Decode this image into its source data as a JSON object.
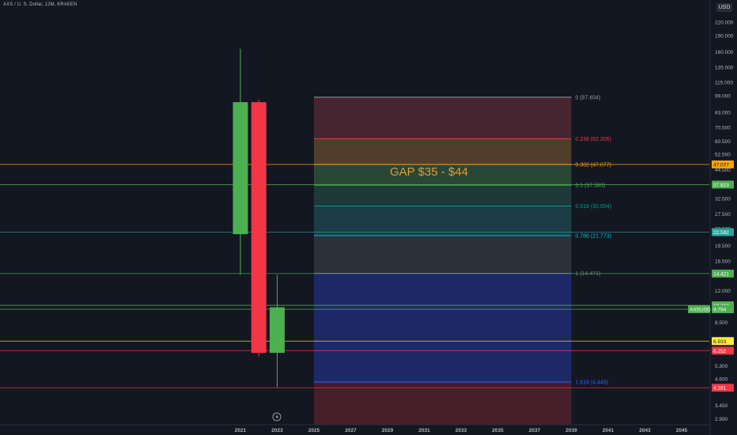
{
  "header": {
    "symbol": "AXS / U. S. Dollar, 12M, KRAKEN",
    "currency": "USD"
  },
  "chart_data": {
    "type": "candlestick",
    "y_scale": "log",
    "ylim": [
      2.8,
      280
    ],
    "y_ticks": [
      {
        "v": 220,
        "label": "220.000"
      },
      {
        "v": 190,
        "label": "190.000"
      },
      {
        "v": 160,
        "label": "160.000"
      },
      {
        "v": 135,
        "label": "135.000"
      },
      {
        "v": 115,
        "label": "115.000"
      },
      {
        "v": 99,
        "label": "99.000"
      },
      {
        "v": 83,
        "label": "83.000"
      },
      {
        "v": 70.5,
        "label": "70.500"
      },
      {
        "v": 60.5,
        "label": "60.500"
      },
      {
        "v": 52.5,
        "label": "52.500"
      },
      {
        "v": 44.5,
        "label": "44.500"
      },
      {
        "v": 32.5,
        "label": "32.500"
      },
      {
        "v": 27.5,
        "label": "27.500"
      },
      {
        "v": 23.5,
        "label": "23.500"
      },
      {
        "v": 19.5,
        "label": "19.500"
      },
      {
        "v": 16.5,
        "label": "16.500"
      },
      {
        "v": 12,
        "label": "12.000"
      },
      {
        "v": 8.5,
        "label": "8.500"
      },
      {
        "v": 6.3,
        "label": "6.300"
      },
      {
        "v": 5.3,
        "label": "5.300"
      },
      {
        "v": 4.6,
        "label": "4.600"
      },
      {
        "v": 3.45,
        "label": "3.450"
      },
      {
        "v": 2.99,
        "label": "2.990"
      }
    ],
    "x_ticks": [
      "2021",
      "2023",
      "2025",
      "2027",
      "2029",
      "2031",
      "2033",
      "2035",
      "2037",
      "2039",
      "2041",
      "2043",
      "2045"
    ],
    "xlim": [
      2019.3,
      2046.6
    ],
    "candles": [
      {
        "t": 2021,
        "open": 22.1,
        "high": 165,
        "low": 14.2,
        "close": 92.5
      },
      {
        "t": 2022,
        "open": 92.5,
        "high": 95,
        "low": 5.85,
        "close": 6.1
      },
      {
        "t": 2023,
        "open": 6.1,
        "high": 14.2,
        "low": 4.2,
        "close": 10.0
      }
    ],
    "fib_retracement": {
      "x_start": 2025.0,
      "x_end": 2039.0,
      "levels": [
        {
          "ratio": "0",
          "price": 97.604,
          "label": "0 (97.604)",
          "color": "#9598a1",
          "fill": "#4a2631"
        },
        {
          "ratio": "0.236",
          "price": 62.206,
          "label": "0.236 (62.206)",
          "color": "#f23645",
          "fill": "#53402c"
        },
        {
          "ratio": "0.382",
          "price": 47.077,
          "label": "0.382 (47.077)",
          "color": "#ff9800",
          "fill": "#2a4a37"
        },
        {
          "ratio": "0.5",
          "price": 37.583,
          "label": "0.5 (37.583)",
          "color": "#4caf50",
          "fill": "#1d3b3c"
        },
        {
          "ratio": "0.618",
          "price": 30.004,
          "label": "0.618 (30.004)",
          "color": "#089981",
          "fill": "#1c3f48"
        },
        {
          "ratio": "0.786",
          "price": 21.773,
          "label": "0.786 (21.773)",
          "color": "#00bcd4",
          "fill": "#2d313a"
        },
        {
          "ratio": "1",
          "price": 14.471,
          "label": "1 (14.471)",
          "color": "#787b86",
          "fill": "#1d2a6b"
        },
        {
          "ratio": "1.618",
          "price": 4.449,
          "label": "1.618 (4.449)",
          "color": "#2962ff",
          "fill": "#481f2b"
        }
      ]
    },
    "annotation": {
      "text": "GAP $35 - $44",
      "color": "#e89a2e"
    },
    "horizontal_lines": [
      {
        "price": 47.077,
        "color": "#f7a600"
      },
      {
        "price": 37.823,
        "color": "#4caf50"
      },
      {
        "price": 22.592,
        "color": "#26a69a"
      },
      {
        "price": 14.421,
        "color": "#4caf50"
      },
      {
        "price": 10.218,
        "color": "#66bb6a"
      },
      {
        "price": 9.794,
        "color": "#66bb6a"
      },
      {
        "price": 6.933,
        "color": "#ffeb3b"
      },
      {
        "price": 6.252,
        "color": "#f23645"
      },
      {
        "price": 4.181,
        "color": "#f23645"
      }
    ],
    "price_badges": [
      {
        "price": 47.077,
        "label": "47.077",
        "bg": "#f7a600",
        "fg": "#131722"
      },
      {
        "price": 37.823,
        "label": "37.823",
        "bg": "#4caf50",
        "fg": "#ffffff"
      },
      {
        "price": 22.592,
        "label": "22.592",
        "bg": "#26a69a",
        "fg": "#ffffff"
      },
      {
        "price": 14.421,
        "label": "14.421",
        "bg": "#4caf50",
        "fg": "#ffffff"
      },
      {
        "price": 10.218,
        "label": "10.218",
        "bg": "#4caf50",
        "fg": "#ffffff"
      },
      {
        "price": 9.794,
        "label": "9.794",
        "bg": "#4caf50",
        "fg": "#ffffff"
      },
      {
        "price": 6.933,
        "label": "6.933",
        "bg": "#ffeb3b",
        "fg": "#131722"
      },
      {
        "price": 6.252,
        "label": "6.252",
        "bg": "#f23645",
        "fg": "#ffffff"
      },
      {
        "price": 4.181,
        "label": "4.181",
        "bg": "#f23645",
        "fg": "#ffffff"
      }
    ],
    "symbol_badge": {
      "label": "AXSUSD",
      "price": 9.794,
      "bg": "#4caf50",
      "fg": "#ffffff"
    },
    "colors": {
      "up": "#4caf50",
      "down": "#f23645",
      "background": "#131722",
      "text": "#b2b5be"
    }
  }
}
